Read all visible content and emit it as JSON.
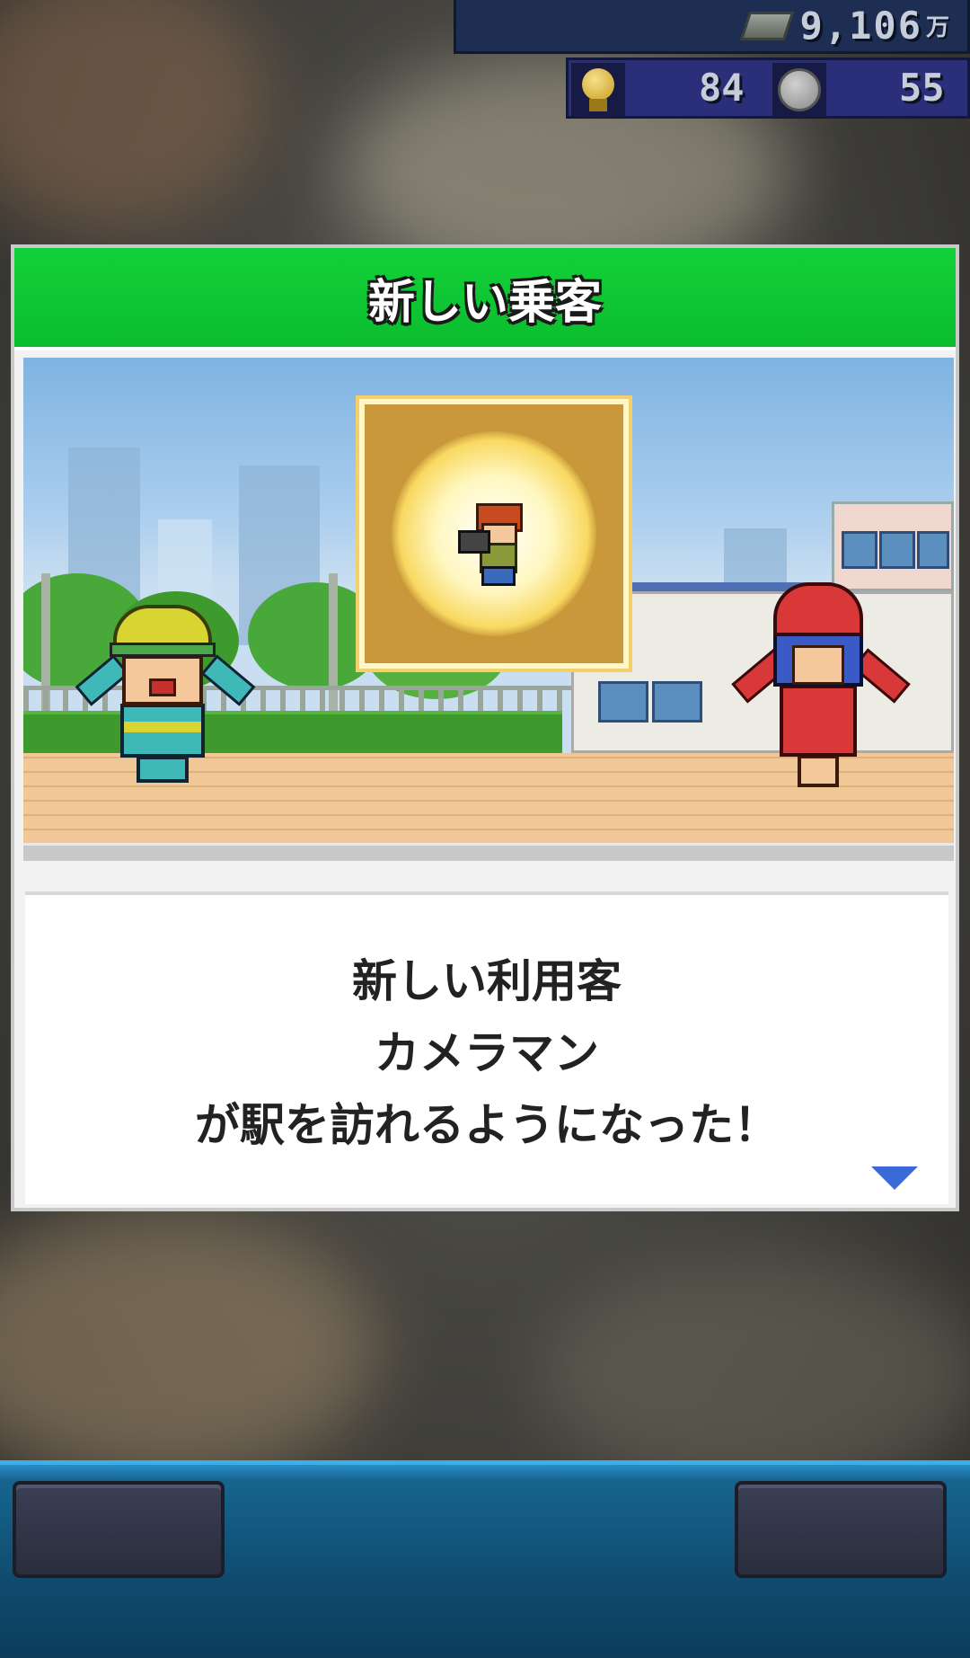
{
  "hud": {
    "money": "9,106",
    "money_unit": "万",
    "idea_points": "84",
    "medals": "55",
    "icons": [
      "money-bill-icon",
      "lightbulb-icon",
      "medal-icon"
    ]
  },
  "dialog": {
    "title": "新しい乗客",
    "message_lines": [
      "新しい利用客",
      "カメラマン",
      "が駅を訪れるようになった！"
    ],
    "header_color": "#0bbd2d",
    "next_icon": "triangle-down-icon"
  },
  "bottom_bar": {
    "left_slot": "",
    "right_slot": ""
  }
}
